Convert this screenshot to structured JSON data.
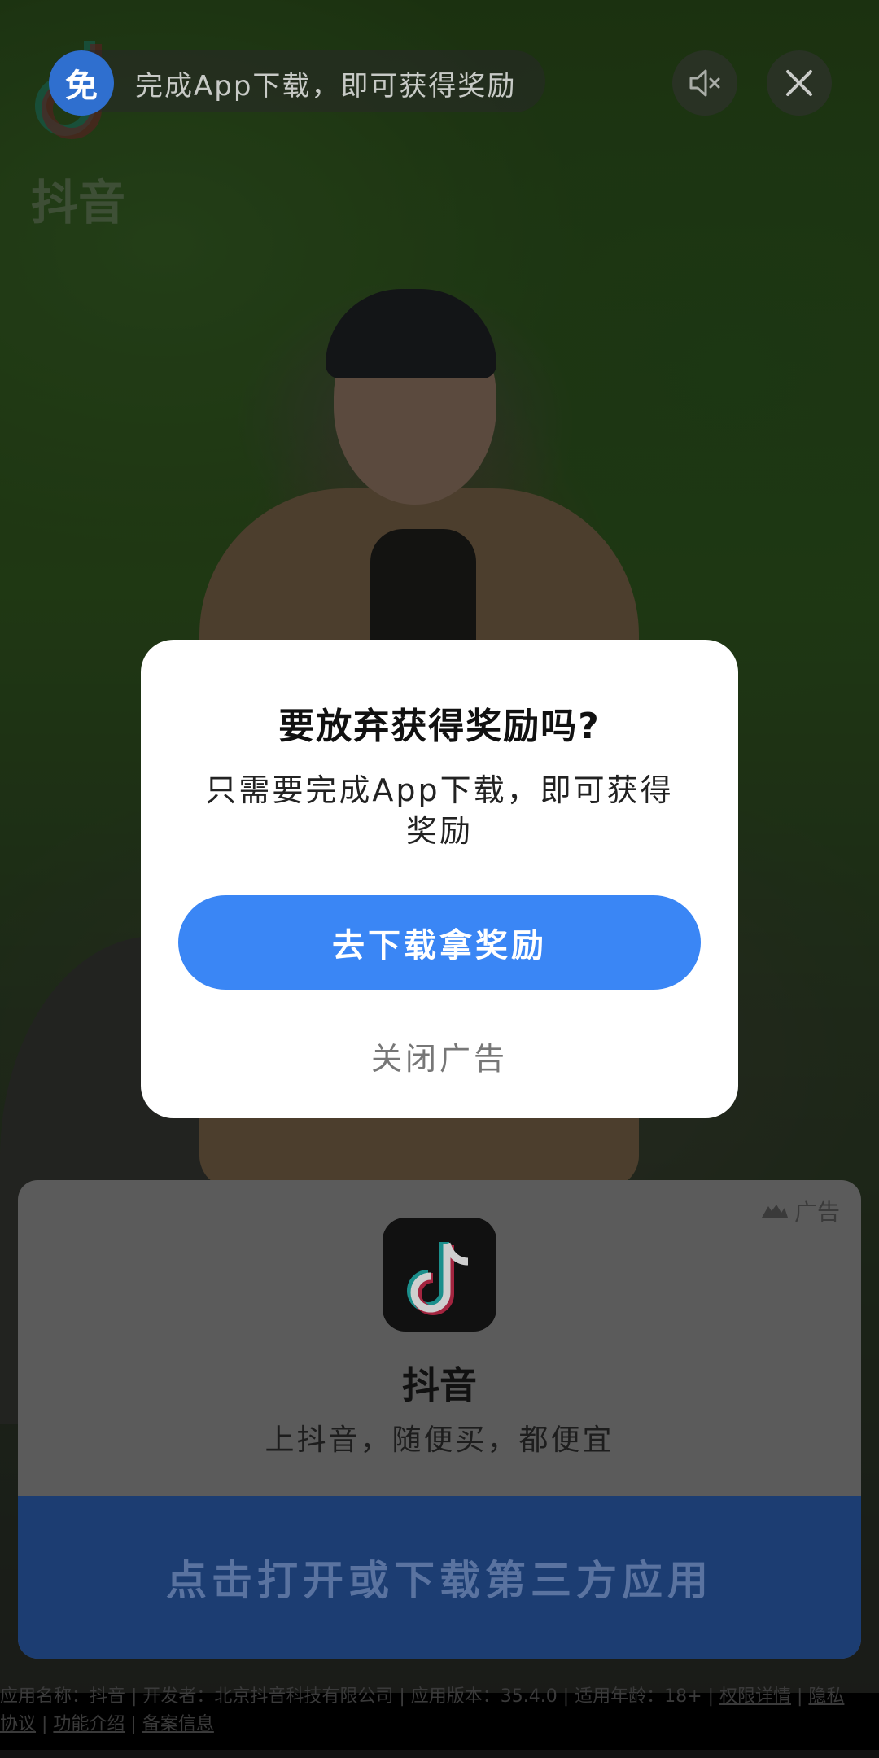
{
  "top_bar": {
    "free_badge": "免",
    "reward_text": "完成App下载，即可获得奖励",
    "bg_logo_text": "抖音",
    "mute_icon": "speaker-muted-icon",
    "close_icon": "close-icon"
  },
  "modal": {
    "title": "要放弃获得奖励吗?",
    "body": "只需要完成App下载，即可获得奖励",
    "download_button": "去下载拿奖励",
    "close_ad": "关闭广告"
  },
  "ad_card": {
    "ad_label": "广告",
    "app_icon": "douyin-logo-icon",
    "app_name": "抖音",
    "slogan": "上抖音，随便买，都便宜",
    "open_button": "点击打开或下载第三方应用"
  },
  "footer": {
    "info": "应用名称：抖音 | 开发者：北京抖音科技有限公司 | 应用版本：35.4.0 | 适用年龄：18+ | ",
    "permissions": "权限详情",
    "privacy": "隐私",
    "privacy_cont": "协议",
    "features": "功能介绍",
    "filing": "备案信息"
  },
  "colors": {
    "accent": "#3a86f5",
    "badge": "#2f6fcf"
  }
}
